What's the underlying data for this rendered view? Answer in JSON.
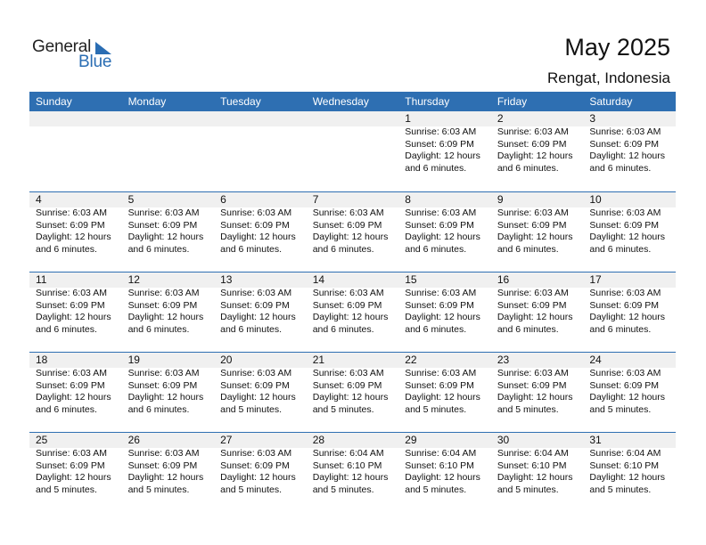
{
  "logo": {
    "word1": "General",
    "word2": "Blue",
    "icon": "triangle-flag-icon",
    "brand_color": "#2a6db3"
  },
  "header": {
    "title": "May 2025",
    "location": "Rengat, Indonesia"
  },
  "colors": {
    "header_bg": "#2e6fb2",
    "daynum_band": "#f0f0f0",
    "rule": "#2e6fb2"
  },
  "weekdays": [
    "Sunday",
    "Monday",
    "Tuesday",
    "Wednesday",
    "Thursday",
    "Friday",
    "Saturday"
  ],
  "weeks": [
    [
      null,
      null,
      null,
      null,
      {
        "day": "1",
        "sunrise": "Sunrise: 6:03 AM",
        "sunset": "Sunset: 6:09 PM",
        "daylight1": "Daylight: 12 hours",
        "daylight2": "and 6 minutes."
      },
      {
        "day": "2",
        "sunrise": "Sunrise: 6:03 AM",
        "sunset": "Sunset: 6:09 PM",
        "daylight1": "Daylight: 12 hours",
        "daylight2": "and 6 minutes."
      },
      {
        "day": "3",
        "sunrise": "Sunrise: 6:03 AM",
        "sunset": "Sunset: 6:09 PM",
        "daylight1": "Daylight: 12 hours",
        "daylight2": "and 6 minutes."
      }
    ],
    [
      {
        "day": "4",
        "sunrise": "Sunrise: 6:03 AM",
        "sunset": "Sunset: 6:09 PM",
        "daylight1": "Daylight: 12 hours",
        "daylight2": "and 6 minutes."
      },
      {
        "day": "5",
        "sunrise": "Sunrise: 6:03 AM",
        "sunset": "Sunset: 6:09 PM",
        "daylight1": "Daylight: 12 hours",
        "daylight2": "and 6 minutes."
      },
      {
        "day": "6",
        "sunrise": "Sunrise: 6:03 AM",
        "sunset": "Sunset: 6:09 PM",
        "daylight1": "Daylight: 12 hours",
        "daylight2": "and 6 minutes."
      },
      {
        "day": "7",
        "sunrise": "Sunrise: 6:03 AM",
        "sunset": "Sunset: 6:09 PM",
        "daylight1": "Daylight: 12 hours",
        "daylight2": "and 6 minutes."
      },
      {
        "day": "8",
        "sunrise": "Sunrise: 6:03 AM",
        "sunset": "Sunset: 6:09 PM",
        "daylight1": "Daylight: 12 hours",
        "daylight2": "and 6 minutes."
      },
      {
        "day": "9",
        "sunrise": "Sunrise: 6:03 AM",
        "sunset": "Sunset: 6:09 PM",
        "daylight1": "Daylight: 12 hours",
        "daylight2": "and 6 minutes."
      },
      {
        "day": "10",
        "sunrise": "Sunrise: 6:03 AM",
        "sunset": "Sunset: 6:09 PM",
        "daylight1": "Daylight: 12 hours",
        "daylight2": "and 6 minutes."
      }
    ],
    [
      {
        "day": "11",
        "sunrise": "Sunrise: 6:03 AM",
        "sunset": "Sunset: 6:09 PM",
        "daylight1": "Daylight: 12 hours",
        "daylight2": "and 6 minutes."
      },
      {
        "day": "12",
        "sunrise": "Sunrise: 6:03 AM",
        "sunset": "Sunset: 6:09 PM",
        "daylight1": "Daylight: 12 hours",
        "daylight2": "and 6 minutes."
      },
      {
        "day": "13",
        "sunrise": "Sunrise: 6:03 AM",
        "sunset": "Sunset: 6:09 PM",
        "daylight1": "Daylight: 12 hours",
        "daylight2": "and 6 minutes."
      },
      {
        "day": "14",
        "sunrise": "Sunrise: 6:03 AM",
        "sunset": "Sunset: 6:09 PM",
        "daylight1": "Daylight: 12 hours",
        "daylight2": "and 6 minutes."
      },
      {
        "day": "15",
        "sunrise": "Sunrise: 6:03 AM",
        "sunset": "Sunset: 6:09 PM",
        "daylight1": "Daylight: 12 hours",
        "daylight2": "and 6 minutes."
      },
      {
        "day": "16",
        "sunrise": "Sunrise: 6:03 AM",
        "sunset": "Sunset: 6:09 PM",
        "daylight1": "Daylight: 12 hours",
        "daylight2": "and 6 minutes."
      },
      {
        "day": "17",
        "sunrise": "Sunrise: 6:03 AM",
        "sunset": "Sunset: 6:09 PM",
        "daylight1": "Daylight: 12 hours",
        "daylight2": "and 6 minutes."
      }
    ],
    [
      {
        "day": "18",
        "sunrise": "Sunrise: 6:03 AM",
        "sunset": "Sunset: 6:09 PM",
        "daylight1": "Daylight: 12 hours",
        "daylight2": "and 6 minutes."
      },
      {
        "day": "19",
        "sunrise": "Sunrise: 6:03 AM",
        "sunset": "Sunset: 6:09 PM",
        "daylight1": "Daylight: 12 hours",
        "daylight2": "and 6 minutes."
      },
      {
        "day": "20",
        "sunrise": "Sunrise: 6:03 AM",
        "sunset": "Sunset: 6:09 PM",
        "daylight1": "Daylight: 12 hours",
        "daylight2": "and 5 minutes."
      },
      {
        "day": "21",
        "sunrise": "Sunrise: 6:03 AM",
        "sunset": "Sunset: 6:09 PM",
        "daylight1": "Daylight: 12 hours",
        "daylight2": "and 5 minutes."
      },
      {
        "day": "22",
        "sunrise": "Sunrise: 6:03 AM",
        "sunset": "Sunset: 6:09 PM",
        "daylight1": "Daylight: 12 hours",
        "daylight2": "and 5 minutes."
      },
      {
        "day": "23",
        "sunrise": "Sunrise: 6:03 AM",
        "sunset": "Sunset: 6:09 PM",
        "daylight1": "Daylight: 12 hours",
        "daylight2": "and 5 minutes."
      },
      {
        "day": "24",
        "sunrise": "Sunrise: 6:03 AM",
        "sunset": "Sunset: 6:09 PM",
        "daylight1": "Daylight: 12 hours",
        "daylight2": "and 5 minutes."
      }
    ],
    [
      {
        "day": "25",
        "sunrise": "Sunrise: 6:03 AM",
        "sunset": "Sunset: 6:09 PM",
        "daylight1": "Daylight: 12 hours",
        "daylight2": "and 5 minutes."
      },
      {
        "day": "26",
        "sunrise": "Sunrise: 6:03 AM",
        "sunset": "Sunset: 6:09 PM",
        "daylight1": "Daylight: 12 hours",
        "daylight2": "and 5 minutes."
      },
      {
        "day": "27",
        "sunrise": "Sunrise: 6:03 AM",
        "sunset": "Sunset: 6:09 PM",
        "daylight1": "Daylight: 12 hours",
        "daylight2": "and 5 minutes."
      },
      {
        "day": "28",
        "sunrise": "Sunrise: 6:04 AM",
        "sunset": "Sunset: 6:10 PM",
        "daylight1": "Daylight: 12 hours",
        "daylight2": "and 5 minutes."
      },
      {
        "day": "29",
        "sunrise": "Sunrise: 6:04 AM",
        "sunset": "Sunset: 6:10 PM",
        "daylight1": "Daylight: 12 hours",
        "daylight2": "and 5 minutes."
      },
      {
        "day": "30",
        "sunrise": "Sunrise: 6:04 AM",
        "sunset": "Sunset: 6:10 PM",
        "daylight1": "Daylight: 12 hours",
        "daylight2": "and 5 minutes."
      },
      {
        "day": "31",
        "sunrise": "Sunrise: 6:04 AM",
        "sunset": "Sunset: 6:10 PM",
        "daylight1": "Daylight: 12 hours",
        "daylight2": "and 5 minutes."
      }
    ]
  ]
}
